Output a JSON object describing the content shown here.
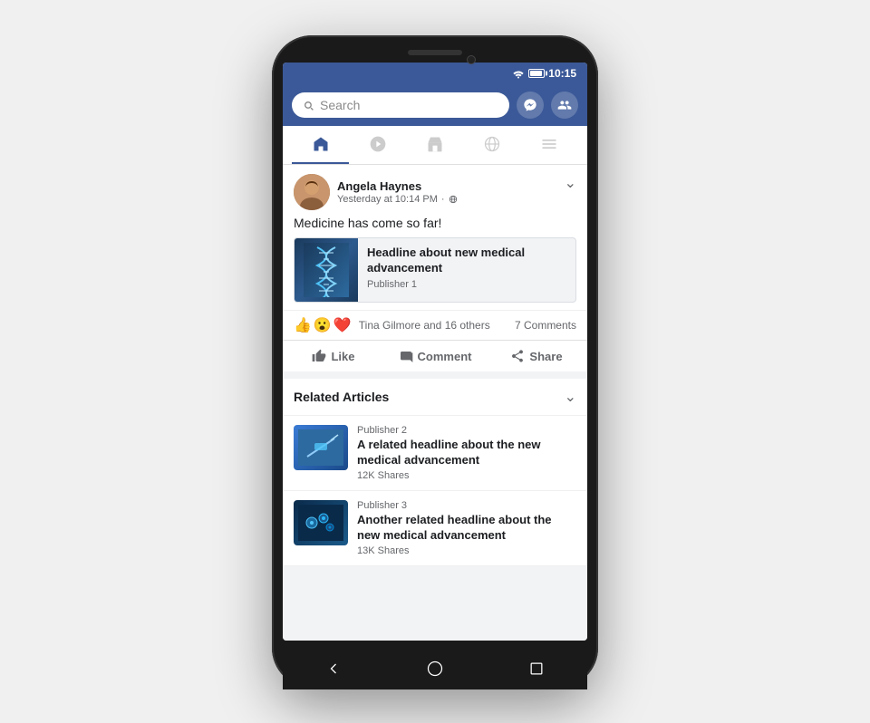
{
  "phone": {
    "status_time": "10:15"
  },
  "search": {
    "placeholder": "Search"
  },
  "nav": {
    "tabs": [
      "news-feed",
      "video",
      "marketplace",
      "globe",
      "menu"
    ]
  },
  "post": {
    "author_name": "Angela Haynes",
    "post_time": "Yesterday at 10:14 PM",
    "post_privacy": "Public",
    "post_text": "Medicine has come so far!",
    "article": {
      "headline": "Headline about new medical advancement",
      "publisher": "Publisher 1"
    },
    "reactions": {
      "emojis": [
        "👍",
        "😮",
        "❤️"
      ],
      "people": "Tina Gilmore and 16 others",
      "comments": "7 Comments"
    },
    "actions": {
      "like": "Like",
      "comment": "Comment",
      "share": "Share"
    }
  },
  "related": {
    "title": "Related Articles",
    "items": [
      {
        "publisher": "Publisher 2",
        "headline": "A related headline about the new medical advancement",
        "shares": "12K Shares"
      },
      {
        "publisher": "Publisher 3",
        "headline": "Another related headline about the new medical advancement",
        "shares": "13K Shares"
      }
    ]
  }
}
